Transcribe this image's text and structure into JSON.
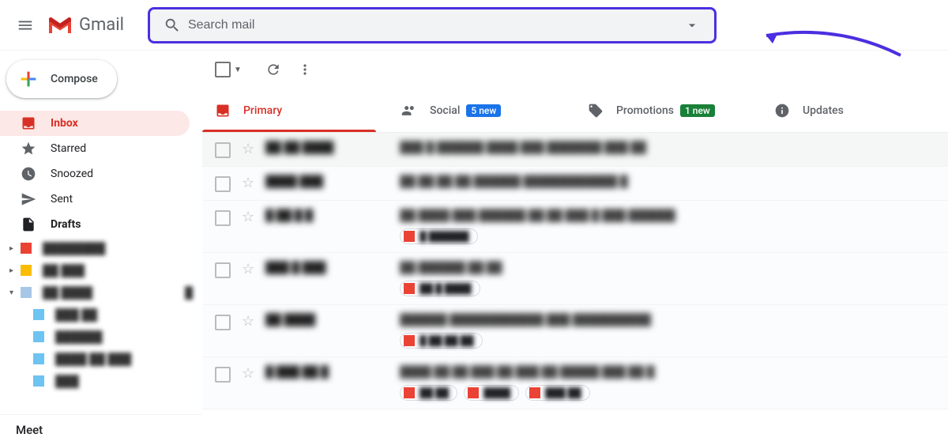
{
  "header": {
    "app_name": "Gmail",
    "search_placeholder": "Search mail"
  },
  "compose": {
    "label": "Compose"
  },
  "nav": {
    "inbox": "Inbox",
    "starred": "Starred",
    "snoozed": "Snoozed",
    "sent": "Sent",
    "drafts": "Drafts"
  },
  "labels": [
    {
      "color": "#ea4335",
      "name": "████████",
      "expanded": false
    },
    {
      "color": "#fbbc04",
      "name": "██ ███",
      "expanded": false
    },
    {
      "color": "#a7c7e7",
      "name": "██ ████",
      "count": "█",
      "expanded": true,
      "children": [
        {
          "color": "#6dc3f2",
          "name": "███ ██"
        },
        {
          "color": "#6dc3f2",
          "name": "██████"
        },
        {
          "color": "#6dc3f2",
          "name": "████ ██ ███"
        },
        {
          "color": "#6dc3f2",
          "name": "███"
        }
      ]
    }
  ],
  "meet": {
    "label": "Meet"
  },
  "tabs": {
    "primary": "Primary",
    "social": "Social",
    "social_badge": "5 new",
    "promotions": "Promotions",
    "promotions_badge": "1 new",
    "updates": "Updates"
  },
  "emails": [
    {
      "sender": "██ ██ ████",
      "subject": "███ █ ██████  ████ ███ ███████  ███ ██"
    },
    {
      "sender": "████ ███",
      "subject": "██ ██ ██ ██ ██████ ████████████ █"
    },
    {
      "sender": "█  ██  █ █",
      "subject": "██  ████  ███ ██████ ██ ██  ███ █  ███ ██████",
      "chip1": "█ ██████"
    },
    {
      "sender": "███ █ ███",
      "subject": "██  ██████  ██ ██",
      "chip1": "██ █ ████"
    },
    {
      "sender": "██ ████",
      "subject": "██████  ████████████ ███  ██████████",
      "chip1": "█ ██ ██ ██"
    },
    {
      "sender": "█  ███ ██ █",
      "subject": "████ ██  ██ ███ ██ ███ ██ █████  ███  ██ █",
      "chip1": "██ ██",
      "chip2": "████",
      "chip3": "███ ██"
    }
  ],
  "colors": {
    "highlight_border": "#4c2fe0",
    "primary_red": "#d93025"
  }
}
